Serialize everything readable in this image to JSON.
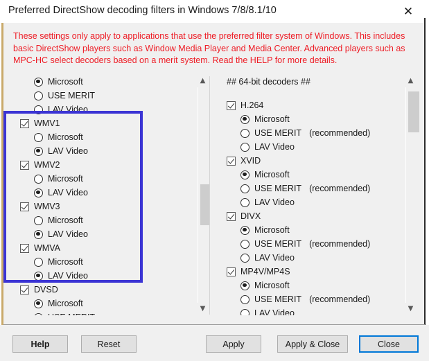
{
  "window": {
    "title": "Preferred DirectShow decoding filters in Windows 7/8/8.1/10",
    "close_icon": "close-x-icon"
  },
  "notice": {
    "text": "These settings only apply to applications that use the preferred filter system of Windows. This includes basic DirectShow players such as Window Media Player and Media Center. Advanced players such as MPC-HC select decoders based on a merit system. Read the HELP for more details.",
    "color": "#ee1c25"
  },
  "colors": {
    "annotation_blue": "#3b34d4",
    "focus_blue": "#0078d7",
    "panel_bg": "#f0f0f0",
    "scroll_thumb": "#cdcdcd"
  },
  "left_panel": {
    "scrollbar": {
      "up_arrow": "chevron-up-icon",
      "down_arrow": "chevron-down-icon",
      "thumb_top_pct": 45,
      "thumb_height_pct": 19
    },
    "rows": [
      {
        "type": "radio",
        "indent": 2,
        "label": "Microsoft",
        "selected": true
      },
      {
        "type": "radio",
        "indent": 2,
        "label": "USE MERIT",
        "selected": false
      },
      {
        "type": "radio",
        "indent": 2,
        "label": "LAV Video",
        "selected": false
      },
      {
        "type": "checkbox",
        "indent": 1,
        "label": "WMV1",
        "checked": true
      },
      {
        "type": "radio",
        "indent": 2,
        "label": "Microsoft",
        "selected": false
      },
      {
        "type": "radio",
        "indent": 2,
        "label": "LAV Video",
        "selected": true
      },
      {
        "type": "checkbox",
        "indent": 1,
        "label": "WMV2",
        "checked": true
      },
      {
        "type": "radio",
        "indent": 2,
        "label": "Microsoft",
        "selected": false
      },
      {
        "type": "radio",
        "indent": 2,
        "label": "LAV Video",
        "selected": true
      },
      {
        "type": "checkbox",
        "indent": 1,
        "label": "WMV3",
        "checked": true
      },
      {
        "type": "radio",
        "indent": 2,
        "label": "Microsoft",
        "selected": false
      },
      {
        "type": "radio",
        "indent": 2,
        "label": "LAV Video",
        "selected": true
      },
      {
        "type": "checkbox",
        "indent": 1,
        "label": "WMVA",
        "checked": true
      },
      {
        "type": "radio",
        "indent": 2,
        "label": "Microsoft",
        "selected": false
      },
      {
        "type": "radio",
        "indent": 2,
        "label": "LAV Video",
        "selected": true
      },
      {
        "type": "checkbox",
        "indent": 1,
        "label": "DVSD",
        "checked": true
      },
      {
        "type": "radio",
        "indent": 2,
        "label": "Microsoft",
        "selected": true
      },
      {
        "type": "radio",
        "indent": 2,
        "label": "USE MERIT",
        "selected": false
      }
    ]
  },
  "right_panel": {
    "heading": "##  64-bit decoders  ##",
    "recommended_note": "(recommended)",
    "scrollbar": {
      "up_arrow": "chevron-up-icon",
      "down_arrow": "chevron-down-icon",
      "thumb_top_pct": 2,
      "thumb_height_pct": 19
    },
    "rows": [
      {
        "type": "heading",
        "indent": 1,
        "label": "##  64-bit decoders  ##"
      },
      {
        "type": "spacer"
      },
      {
        "type": "checkbox",
        "indent": 1,
        "label": "H.264",
        "checked": true
      },
      {
        "type": "radio",
        "indent": 2,
        "label": "Microsoft",
        "selected": true
      },
      {
        "type": "radio",
        "indent": 2,
        "label": "USE MERIT",
        "selected": false,
        "note": "(recommended)"
      },
      {
        "type": "radio",
        "indent": 2,
        "label": "LAV Video",
        "selected": false
      },
      {
        "type": "checkbox",
        "indent": 1,
        "label": "XVID",
        "checked": true
      },
      {
        "type": "radio",
        "indent": 2,
        "label": "Microsoft",
        "selected": true
      },
      {
        "type": "radio",
        "indent": 2,
        "label": "USE MERIT",
        "selected": false,
        "note": "(recommended)"
      },
      {
        "type": "radio",
        "indent": 2,
        "label": "LAV Video",
        "selected": false
      },
      {
        "type": "checkbox",
        "indent": 1,
        "label": "DIVX",
        "checked": true
      },
      {
        "type": "radio",
        "indent": 2,
        "label": "Microsoft",
        "selected": true
      },
      {
        "type": "radio",
        "indent": 2,
        "label": "USE MERIT",
        "selected": false,
        "note": "(recommended)"
      },
      {
        "type": "radio",
        "indent": 2,
        "label": "LAV Video",
        "selected": false
      },
      {
        "type": "checkbox",
        "indent": 1,
        "label": "MP4V/MP4S",
        "checked": true
      },
      {
        "type": "radio",
        "indent": 2,
        "label": "Microsoft",
        "selected": true
      },
      {
        "type": "radio",
        "indent": 2,
        "label": "USE MERIT",
        "selected": false,
        "note": "(recommended)"
      },
      {
        "type": "radio",
        "indent": 2,
        "label": "LAV Video",
        "selected": false
      }
    ]
  },
  "buttons": {
    "help": "Help",
    "reset": "Reset",
    "apply": "Apply",
    "apply_close": "Apply & Close",
    "close": "Close"
  }
}
